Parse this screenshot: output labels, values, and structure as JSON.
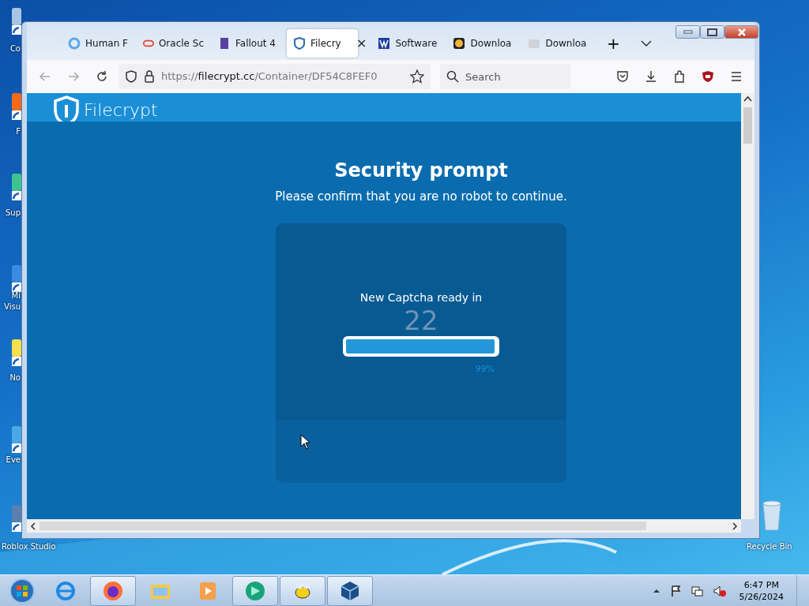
{
  "desktop_icons": [
    {
      "lines": [
        "Co"
      ]
    },
    {
      "lines": [
        "F"
      ]
    },
    {
      "lines": [
        "Sup"
      ]
    },
    {
      "lines": [
        "Mi",
        "Visu"
      ]
    },
    {
      "lines": [
        "No"
      ]
    },
    {
      "lines": [
        "Eve"
      ]
    },
    {
      "lines": [
        "Roblox Studio"
      ]
    },
    {
      "lines": [
        "Recycle Bin"
      ]
    }
  ],
  "browser": {
    "tabs": [
      {
        "label": "Human F",
        "selected": false
      },
      {
        "label": "Oracle Sc",
        "selected": false
      },
      {
        "label": "Fallout 4",
        "selected": false
      },
      {
        "label": "Filecry",
        "selected": true,
        "close": "×"
      },
      {
        "label": "Software",
        "selected": false
      },
      {
        "label": "Downloa",
        "selected": false
      },
      {
        "label": "Downloa",
        "selected": false
      }
    ],
    "new_tab": "+",
    "address": {
      "scheme": "https://",
      "host": "filecrypt.cc",
      "path": "/Container/DF54C8FEF0"
    },
    "search": {
      "placeholder": "Search"
    }
  },
  "page": {
    "logo": "Filecrypt",
    "title": "Security prompt",
    "subtitle": "Please confirm that you are no robot to continue.",
    "captcha": {
      "label": "New Captcha ready in",
      "countdown": "22",
      "level": 0.99,
      "reading": "99%"
    }
  },
  "taskbar": {
    "apps": [
      {
        "selected": false
      },
      {
        "selected": true
      },
      {
        "selected": false
      },
      {
        "selected": false
      },
      {
        "selected": true
      },
      {
        "selected": true
      },
      {
        "selected": true
      }
    ],
    "clock": {
      "time": "6:47 PM",
      "date": "5/26/2024"
    }
  }
}
